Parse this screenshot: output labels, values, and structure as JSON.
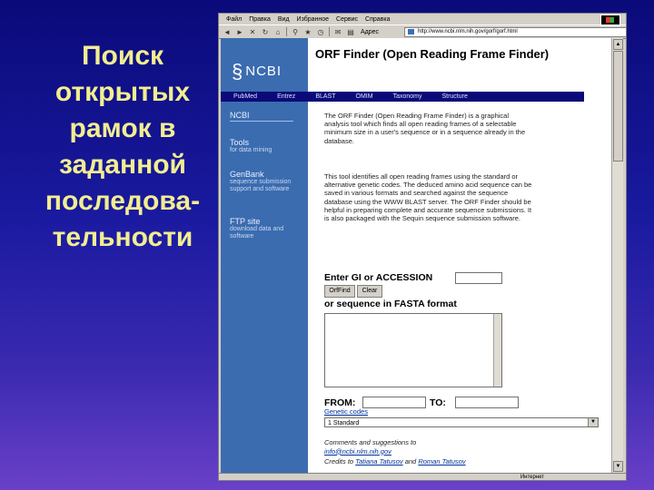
{
  "slide": {
    "title": "Поиск\nоткрытых\nрамок в\nзаданной\nпоследова-\nтельности"
  },
  "browser": {
    "menu": [
      "Файл",
      "Правка",
      "Вид",
      "Избранное",
      "Сервис",
      "Справка"
    ],
    "address_label": "Адрес",
    "address_value": "http://www.ncbi.nlm.nih.gov/gorf/gorf.html",
    "status_zone": "Интернет"
  },
  "page": {
    "logo": "NCBI",
    "title": "ORF Finder (Open Reading Frame Finder)",
    "nav": [
      "PubMed",
      "Entrez",
      "BLAST",
      "OMIM",
      "Taxonomy",
      "Structure"
    ],
    "sidebar": {
      "header": "NCBI",
      "links": [
        {
          "label": "Tools",
          "sub": "for data mining"
        },
        {
          "label": "GenBank",
          "sub": "sequence submission support and software"
        },
        {
          "label": "FTP site",
          "sub": "download data and software"
        }
      ]
    },
    "description_1": "The ORF Finder (Open Reading Frame Finder) is a graphical analysis tool which finds all open reading frames of a selectable minimum size in a user's sequence or in a sequence already in the database.",
    "description_2": "This tool identifies all open reading frames using the standard or alternative genetic codes. The deduced amino acid sequence can be saved in various formats and searched against the sequence database using the WWW BLAST server. The ORF Finder should be helpful in preparing complete and accurate sequence submissions. It is also packaged with the Sequin sequence submission software.",
    "form": {
      "gi_label": "Enter GI or ACCESSION",
      "orffind_button": "OrfFind",
      "clear_button": "Clear",
      "fasta_label": "or sequence in FASTA format",
      "from_label": "FROM:",
      "to_label": "TO:",
      "genetic_codes_link": "Genetic codes",
      "genetic_code_selected": "1 Standard"
    },
    "footer": {
      "line1": "Comments and suggestions to",
      "email": "info@ncbi.nlm.nih.gov",
      "credits_prefix": "Credits to",
      "credit_1": "Tatiana Tatusov",
      "credits_and": "and",
      "credit_2": "Roman Tatusov"
    }
  }
}
